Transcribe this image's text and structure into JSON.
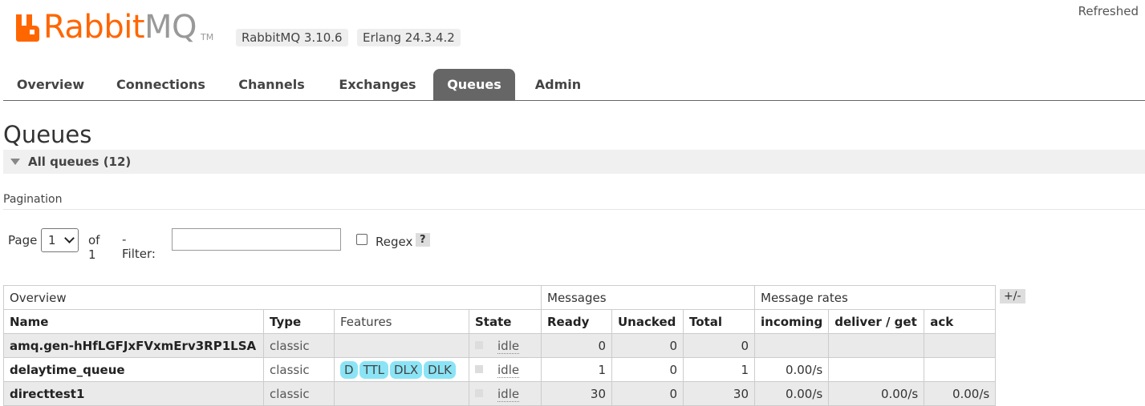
{
  "header": {
    "logo_rabbit": "Rabbit",
    "logo_mq": "MQ",
    "logo_tm": "TM",
    "version": "RabbitMQ 3.10.6",
    "erlang": "Erlang 24.3.4.2",
    "refreshed": "Refreshed",
    "brand_color": "#ff6600"
  },
  "tabs": [
    {
      "label": "Overview"
    },
    {
      "label": "Connections"
    },
    {
      "label": "Channels"
    },
    {
      "label": "Exchanges"
    },
    {
      "label": "Queues",
      "active": true
    },
    {
      "label": "Admin"
    }
  ],
  "page_title": "Queues",
  "section": {
    "label": "All queues (12)"
  },
  "pagination": {
    "title": "Pagination",
    "page_label": "Page",
    "page_value": "1",
    "of_label": "of 1",
    "filter_label": "- Filter:",
    "filter_value": "",
    "regex_label": "Regex",
    "help_label": "?"
  },
  "table": {
    "groups": [
      "Overview",
      "Messages",
      "Message rates"
    ],
    "columns": [
      "Name",
      "Type",
      "Features",
      "State",
      "Ready",
      "Unacked",
      "Total",
      "incoming",
      "deliver / get",
      "ack"
    ],
    "toggle_label": "+/-",
    "rows": [
      {
        "name": "amq.gen-hHfLGFJxFVxmErv3RP1LSA",
        "type": "classic",
        "features": [],
        "state": "idle",
        "ready": "0",
        "unacked": "0",
        "total": "0",
        "incoming": "",
        "deliver_get": "",
        "ack": ""
      },
      {
        "name": "delaytime_queue",
        "type": "classic",
        "features": [
          "D",
          "TTL",
          "DLX",
          "DLK"
        ],
        "state": "idle",
        "ready": "1",
        "unacked": "0",
        "total": "1",
        "incoming": "0.00/s",
        "deliver_get": "",
        "ack": ""
      },
      {
        "name": "directtest1",
        "type": "classic",
        "features": [],
        "state": "idle",
        "ready": "30",
        "unacked": "0",
        "total": "30",
        "incoming": "0.00/s",
        "deliver_get": "0.00/s",
        "ack": "0.00/s"
      }
    ]
  }
}
